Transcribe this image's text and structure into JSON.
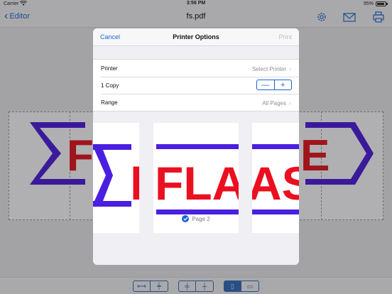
{
  "status_bar": {
    "carrier": "Carrier",
    "time": "3:56 PM",
    "battery": "95%"
  },
  "nav": {
    "back_label": "Editor",
    "title": "fs.pdf",
    "icons": [
      "gear-icon",
      "mail-icon",
      "printer-icon"
    ]
  },
  "modal": {
    "cancel_label": "Cancel",
    "title": "Printer Options",
    "print_label": "Print",
    "rows": {
      "printer": {
        "label": "Printer",
        "value": "Select Printer"
      },
      "copies": {
        "label": "1 Copy",
        "minus": "—",
        "plus": "+"
      },
      "range": {
        "label": "Range",
        "value": "All Pages"
      }
    },
    "pages": {
      "selected_label": "Page 2",
      "page1_text": "F",
      "page2_text": "FLA",
      "page3_text": "AS"
    }
  },
  "colors": {
    "accent": "#1a62d6",
    "banner_purple": "#4a1fe0",
    "banner_red": "#ea1020",
    "bg_banner_purple": "#3a1a9a",
    "bg_banner_red": "#a0141c"
  },
  "background_doc": {
    "left_text": "F",
    "right_text": "E"
  }
}
